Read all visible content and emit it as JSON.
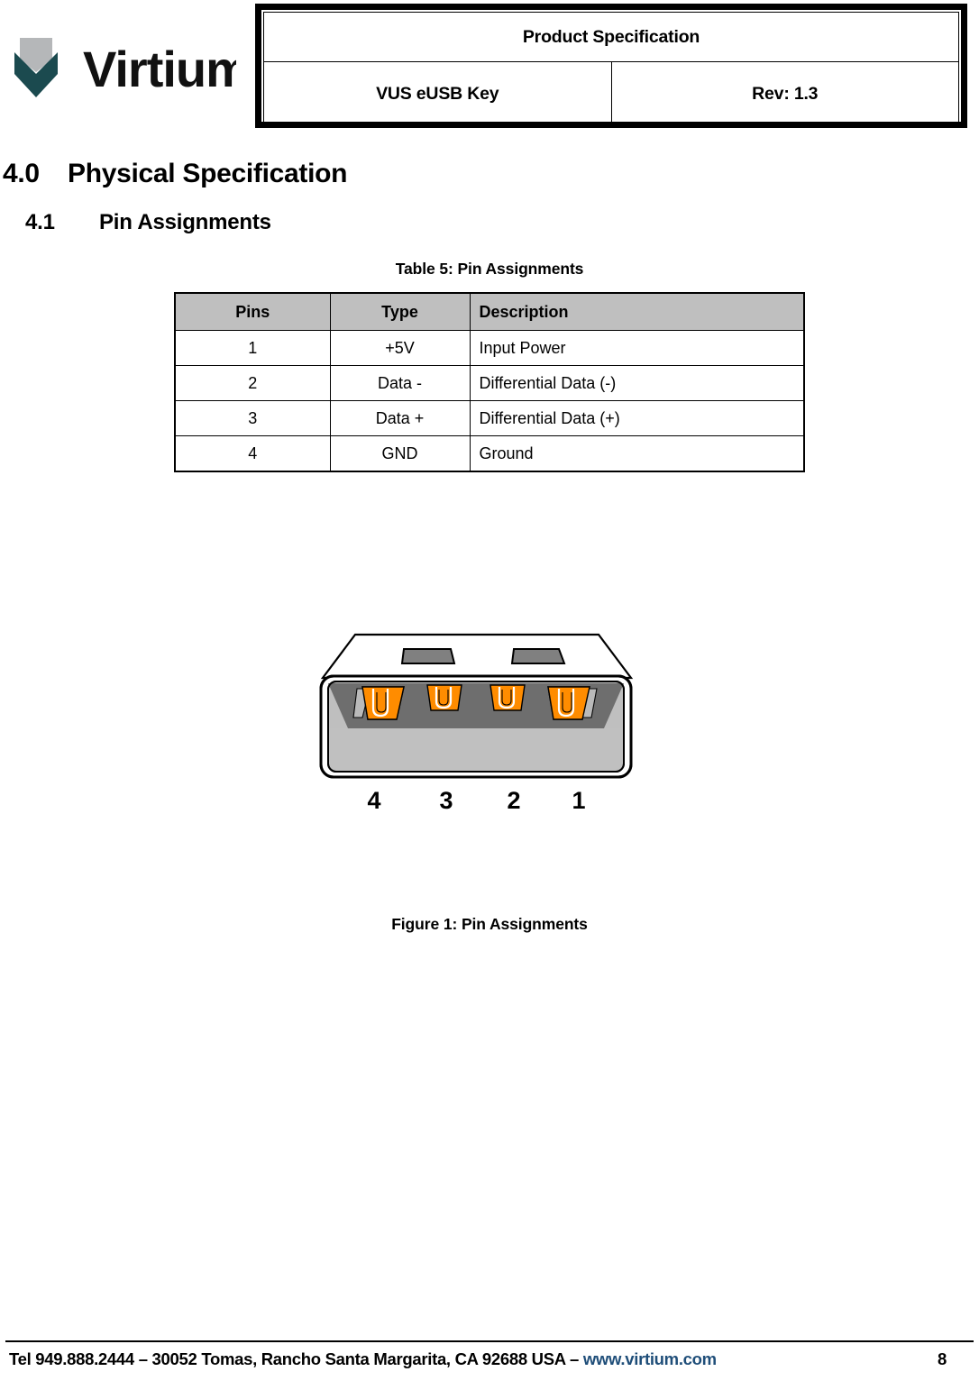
{
  "header": {
    "logo_text": "Virtium",
    "logo_colors": {
      "top_chevron": "#b5b7b9",
      "bottom_chevron": "#1b4a4f"
    },
    "doc_type": "Product Specification",
    "product": "VUS eUSB Key",
    "revision": "Rev: 1.3"
  },
  "sections": {
    "s40": {
      "number": "4.0",
      "title": "Physical Specification"
    },
    "s41": {
      "number": "4.1",
      "title": "Pin Assignments"
    }
  },
  "table": {
    "caption": "Table 5: Pin Assignments",
    "header_bg": "#bfbfbf",
    "columns": [
      "Pins",
      "Type",
      "Description"
    ],
    "rows": [
      {
        "pin": "1",
        "type": "+5V",
        "description": "Input Power"
      },
      {
        "pin": "2",
        "type": "Data -",
        "description": "Differential Data (-)"
      },
      {
        "pin": "3",
        "type": "Data +",
        "description": "Differential Data (+)"
      },
      {
        "pin": "4",
        "type": "GND",
        "description": "Ground"
      }
    ]
  },
  "figure": {
    "caption": "Figure 1: Pin Assignments",
    "alt": "eUSB key connector end view with four gold contacts",
    "pin_labels": [
      "4",
      "3",
      "2",
      "1"
    ],
    "colors": {
      "contact": "#ff8c00",
      "housing_top": "#ffffff",
      "housing_upper_body": "#808080",
      "housing_lower_body": "#c0c0c0",
      "slot": "#808080"
    }
  },
  "footer": {
    "contact": "Tel 949.888.2444 – 30052 Tomas, Rancho Santa Margarita, CA 92688  USA – ",
    "url": "www.virtium.com",
    "url_color": "#1f4e79",
    "page": "8"
  }
}
